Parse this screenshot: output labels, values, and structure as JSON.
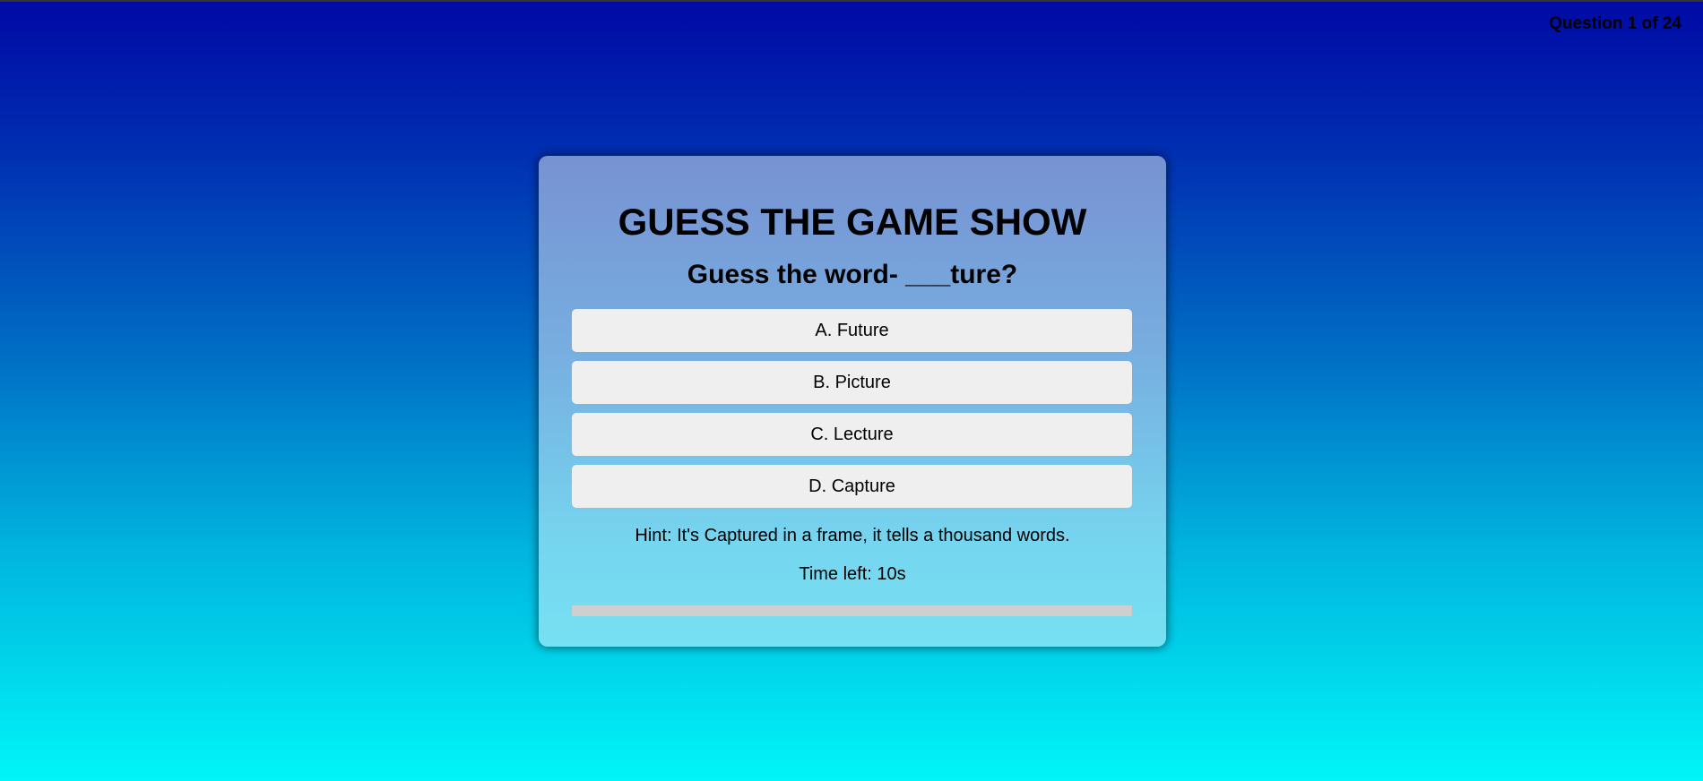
{
  "header": {
    "question_counter": "Question 1 of 24"
  },
  "quiz": {
    "title": "GUESS THE GAME SHOW",
    "question": "Guess the word- ___ture?",
    "options": [
      {
        "label": "A. Future"
      },
      {
        "label": "B. Picture"
      },
      {
        "label": "C. Lecture"
      },
      {
        "label": "D. Capture"
      }
    ],
    "hint": "Hint: It's Captured in a frame, it tells a thousand words.",
    "timer": "Time left: 10s",
    "progress_fraction": 0
  },
  "colors": {
    "option_background": "#efefef",
    "progress_track": "#cfcfcf"
  }
}
